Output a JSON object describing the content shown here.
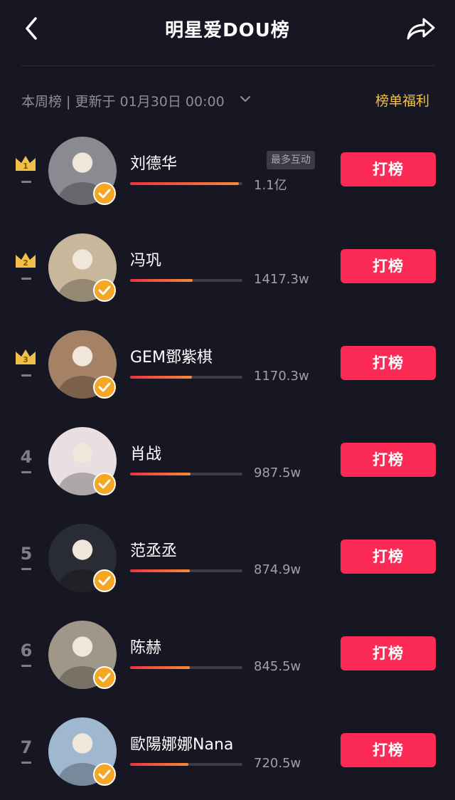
{
  "header": {
    "title": "明星爱DOU榜",
    "back_icon": "chevron-left-icon",
    "share_icon": "share-arrow-icon"
  },
  "subbar": {
    "period": "本周榜 | 更新于 01月30日 00:00",
    "welfare": "榜单福利"
  },
  "colors": {
    "background": "#161722",
    "accent": "#fc2b55",
    "gold": "#f2c04a",
    "verified": "#f5a623"
  },
  "vote_label": "打榜",
  "rankings": [
    {
      "rank": "1",
      "name": "刘德华",
      "value": "1.1亿",
      "progress": 0.97,
      "tag": "最多互动",
      "avatar_color": "#8a8b90"
    },
    {
      "rank": "2",
      "name": "冯巩",
      "value": "1417.3w",
      "progress": 0.56,
      "avatar_color": "#c9b79b"
    },
    {
      "rank": "3",
      "name": "GEM鄧紫棋",
      "value": "1170.3w",
      "progress": 0.55,
      "avatar_color": "#a58266"
    },
    {
      "rank": "4",
      "name": "肖战",
      "value": "987.5w",
      "progress": 0.54,
      "avatar_color": "#e9dfe2"
    },
    {
      "rank": "5",
      "name": "范丞丞",
      "value": "874.9w",
      "progress": 0.53,
      "avatar_color": "#2a2c35"
    },
    {
      "rank": "6",
      "name": "陈赫",
      "value": "845.5w",
      "progress": 0.53,
      "avatar_color": "#a09789"
    },
    {
      "rank": "7",
      "name": "歐陽娜娜Nana",
      "value": "720.5w",
      "progress": 0.52,
      "avatar_color": "#9fb7cf"
    }
  ]
}
